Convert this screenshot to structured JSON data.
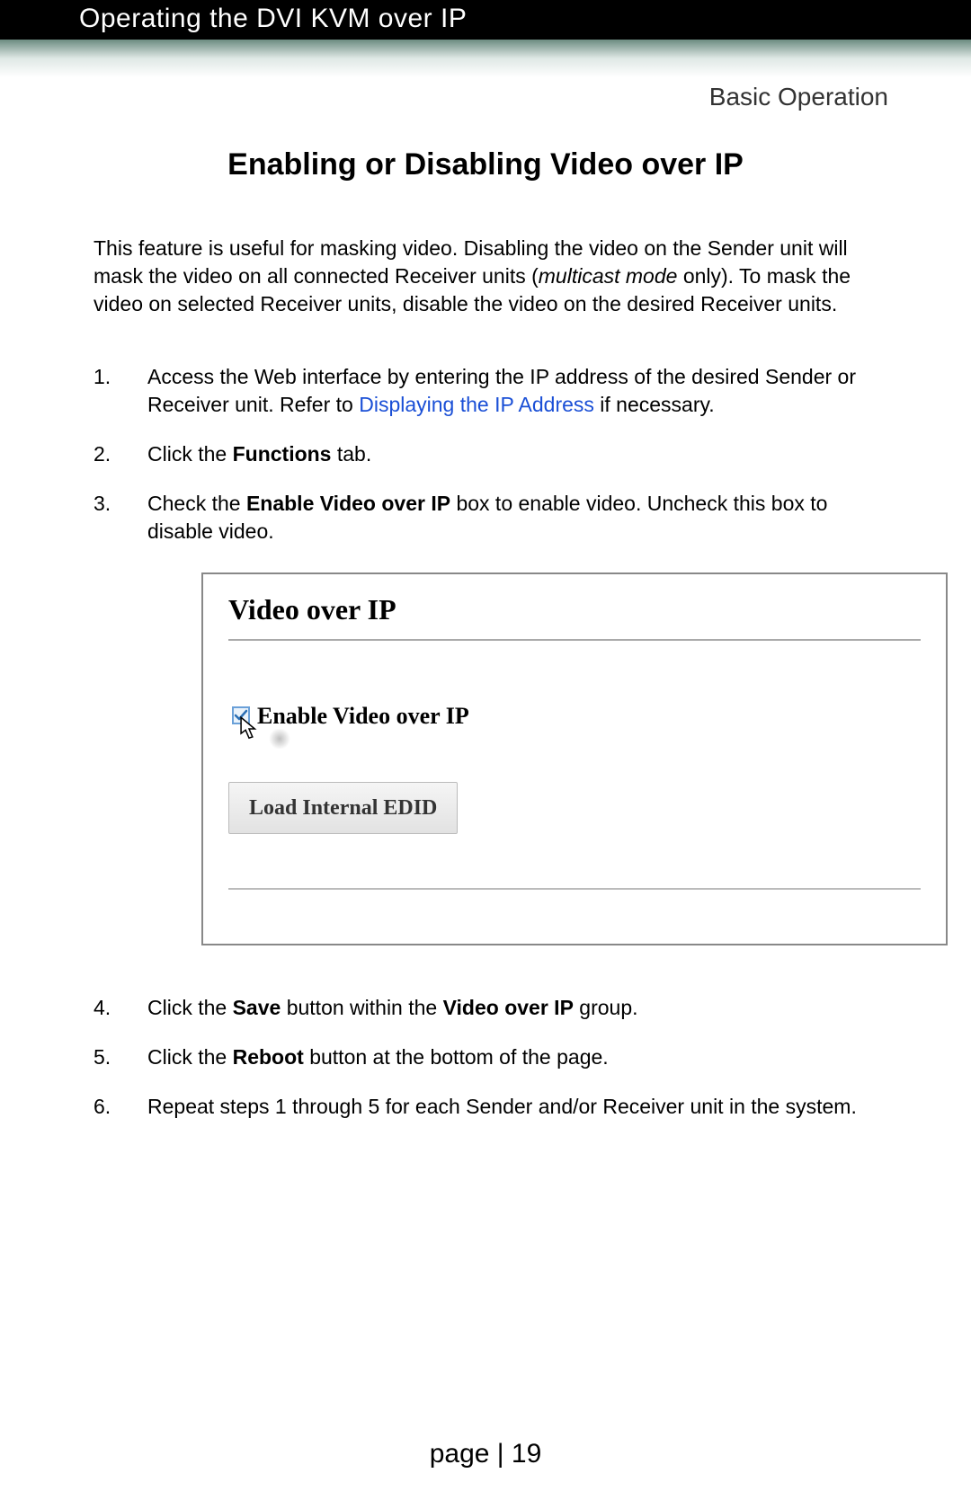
{
  "header": {
    "chapter_title": "Operating the DVI KVM over IP",
    "breadcrumb": "Basic Operation"
  },
  "title": "Enabling or Disabling Video over IP",
  "intro": {
    "pre": "This feature is useful for masking video.  Disabling the video on the Sender unit will mask the video on all connected Receiver units (",
    "italic": "multicast mode",
    "post": " only).  To mask the video on selected Receiver units, disable the video on the desired Receiver units."
  },
  "steps": {
    "s1": {
      "pre": "Access the Web interface by entering the IP address of the desired Sender or Receiver unit.  Refer to ",
      "link": "Displaying the IP Address",
      "post": " if necessary."
    },
    "s2": {
      "pre": "Click the ",
      "bold": "Functions",
      "post": " tab."
    },
    "s3": {
      "pre": "Check the ",
      "bold": "Enable Video over IP",
      "post": " box to enable video.  Uncheck this box to disable video."
    },
    "s4": {
      "pre": "Click the ",
      "bold1": "Save",
      "mid": " button within the ",
      "bold2": "Video over IP",
      "post": " group."
    },
    "s5": {
      "pre": "Click the ",
      "bold": "Reboot",
      "post": " button at the bottom of the page."
    },
    "s6": "Repeat steps 1 through 5 for each Sender and/or Receiver unit in the system."
  },
  "screenshot": {
    "legend": "Video over IP",
    "checkbox_label": "Enable Video over IP",
    "button_label": "Load Internal EDID"
  },
  "footer": {
    "label": "page",
    "sep": " | ",
    "number": "19"
  }
}
